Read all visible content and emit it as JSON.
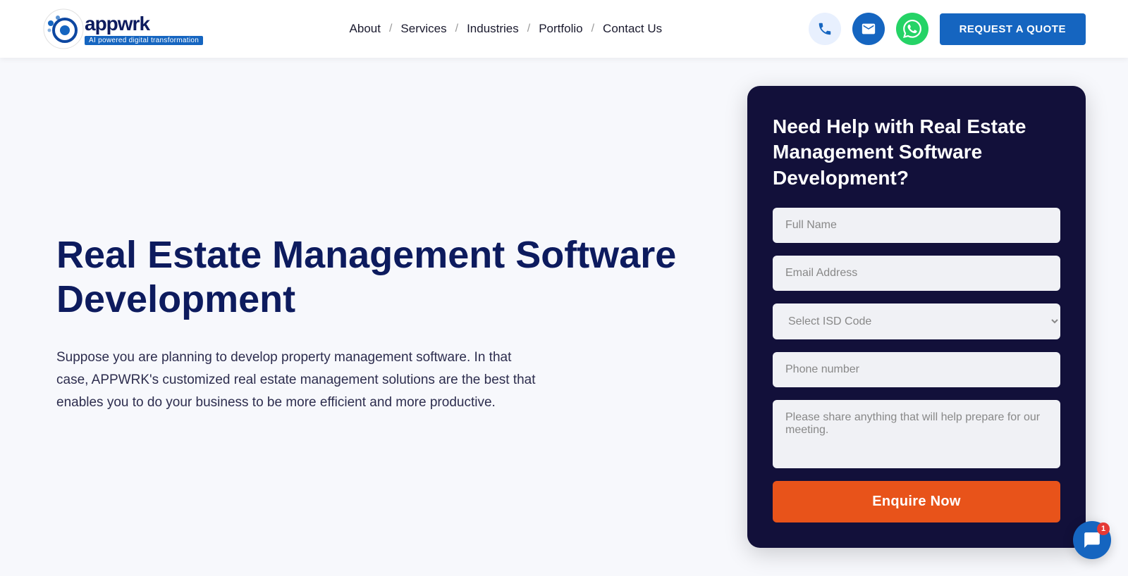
{
  "header": {
    "logo_name": "appwrk",
    "logo_tagline": "AI powered digital transformation",
    "nav": [
      {
        "label": "About",
        "sep": "/"
      },
      {
        "label": "Services",
        "sep": "/"
      },
      {
        "label": "Industries",
        "sep": "/"
      },
      {
        "label": "Portfolio",
        "sep": "/"
      },
      {
        "label": "Contact Us",
        "sep": ""
      }
    ],
    "cta_label": "REQUEST A QUOTE"
  },
  "hero": {
    "title": "Real Estate Management Software Development",
    "description": "Suppose you are planning to develop property management software. In that case, APPWRK's customized real estate management solutions are the best that enables you to do your business to be more efficient and more productive."
  },
  "form": {
    "title": "Need Help with Real Estate Management Software Development?",
    "fullname_placeholder": "Full Name",
    "email_placeholder": "Email Address",
    "isd_placeholder": "Select ISD Code",
    "phone_placeholder": "Phone number",
    "message_placeholder": "Please share anything that will help prepare for our meeting.",
    "submit_label": "Enquire Now"
  },
  "chat": {
    "badge": "1"
  }
}
